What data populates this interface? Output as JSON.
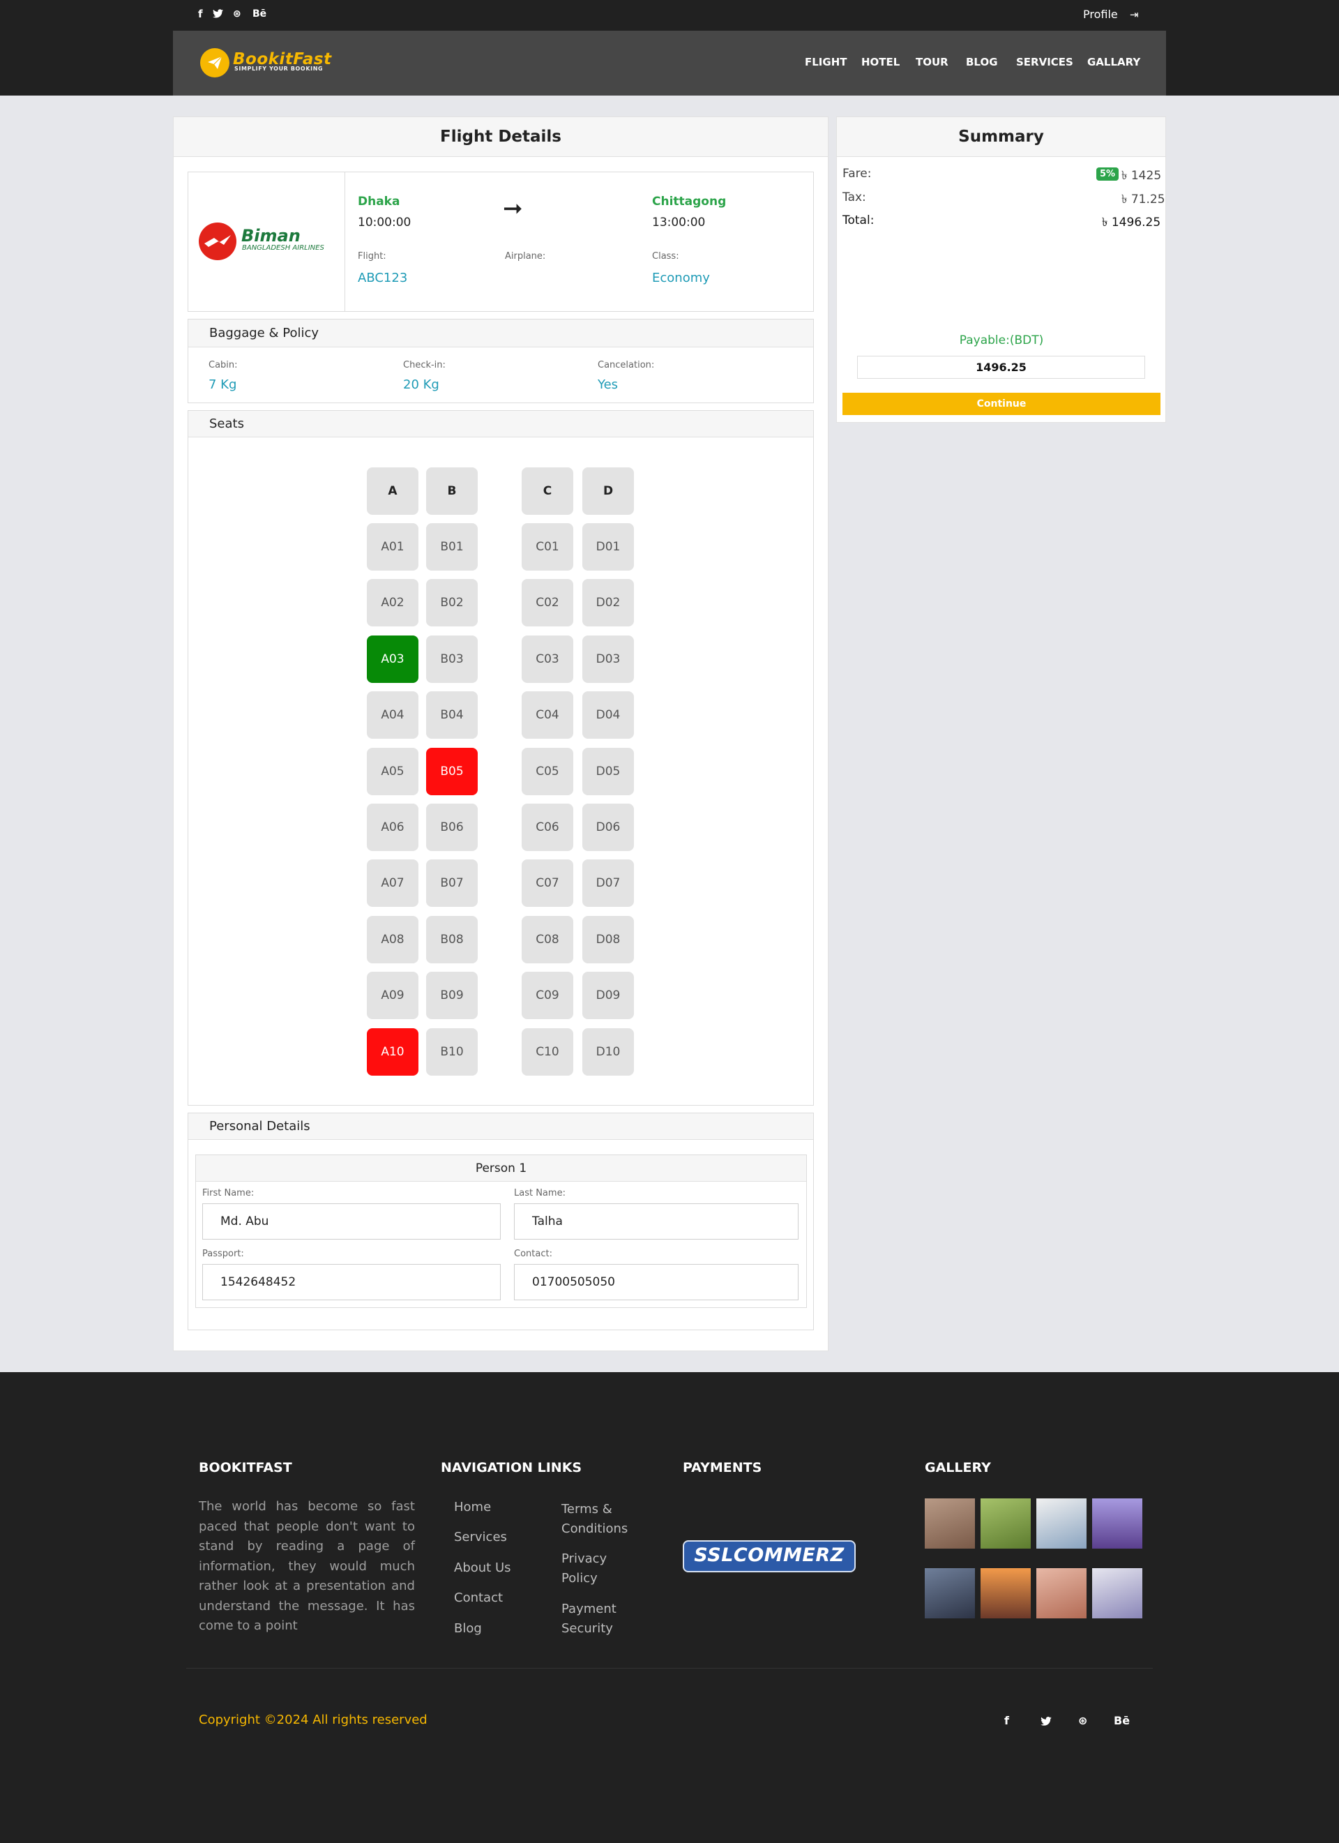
{
  "topbar": {
    "social": [
      "f",
      "🐦",
      "⊛",
      "Bē"
    ],
    "profile_label": "Profile",
    "logout_icon": "⇥"
  },
  "brand": {
    "name": "BookitFast",
    "tagline": "SIMPLIFY YOUR BOOKING"
  },
  "nav": [
    "FLIGHT",
    "HOTEL",
    "TOUR",
    "BLOG",
    "SERVICES",
    "GALLARY"
  ],
  "flight_details": {
    "title": "Flight Details",
    "airline_name": "Biman",
    "airline_sub": "BANGLADESH AIRLINES",
    "from_city": "Dhaka",
    "from_time": "10:00:00",
    "to_city": "Chittagong",
    "to_time": "13:00:00",
    "arrow": "➞",
    "flight_label": "Flight:",
    "flight_value": "ABC123",
    "airplane_label": "Airplane:",
    "class_label": "Class:",
    "class_value": "Economy"
  },
  "baggage": {
    "title": "Baggage & Policy",
    "cabin_label": "Cabin:",
    "cabin_value": "7 Kg",
    "checkin_label": "Check-in:",
    "checkin_value": "20 Kg",
    "cancel_label": "Cancelation:",
    "cancel_value": "Yes"
  },
  "seats": {
    "title": "Seats",
    "columns": [
      "A",
      "B",
      "C",
      "D"
    ],
    "rows": [
      [
        "A01",
        "B01",
        "C01",
        "D01"
      ],
      [
        "A02",
        "B02",
        "C02",
        "D02"
      ],
      [
        "A03",
        "B03",
        "C03",
        "D03"
      ],
      [
        "A04",
        "B04",
        "C04",
        "D04"
      ],
      [
        "A05",
        "B05",
        "C05",
        "D05"
      ],
      [
        "A06",
        "B06",
        "C06",
        "D06"
      ],
      [
        "A07",
        "B07",
        "C07",
        "D07"
      ],
      [
        "A08",
        "B08",
        "C08",
        "D08"
      ],
      [
        "A09",
        "B09",
        "C09",
        "D09"
      ],
      [
        "A10",
        "B10",
        "C10",
        "D10"
      ]
    ],
    "selected": [
      "A03"
    ],
    "booked": [
      "B05",
      "A10"
    ],
    "colors": {
      "default": "#e3e3e3",
      "selected": "#078a07",
      "booked": "#ff0d0d"
    }
  },
  "personal": {
    "title": "Personal Details",
    "person_title": "Person 1",
    "first_name_label": "First Name:",
    "first_name_value": "Md. Abu",
    "last_name_label": "Last Name:",
    "last_name_value": "Talha",
    "passport_label": "Passport:",
    "passport_value": "1542648452",
    "contact_label": "Contact:",
    "contact_value": "01700505050"
  },
  "summary": {
    "title": "Summary",
    "fare_label": "Fare:",
    "fare_badge": "5%",
    "fare_value": "৳ 1425",
    "tax_label": "Tax:",
    "tax_value": "৳ 71.25",
    "total_label": "Total:",
    "total_value": "৳ 1496.25",
    "payable_label": "Payable:(BDT)",
    "payable_value": "1496.25",
    "continue_label": "Continue",
    "accent": "#f7b801"
  },
  "footer": {
    "about_title": "BOOKITFAST",
    "about_text": "The world has become so fast paced that people don't want to stand by reading a page of information, they would much rather look at a presentation and understand the message. It has come to a point",
    "nav_title": "NAVIGATION LINKS",
    "links_col1": [
      "Home",
      "Services",
      "About Us",
      "Contact",
      "Blog"
    ],
    "links_col2": [
      "Terms & Conditions",
      "Privacy Policy",
      "Payment Security"
    ],
    "payments_title": "PAYMENTS",
    "payment_logo": "SSLCOMMERZ",
    "gallery_title": "GALLERY",
    "copyright": "Copyright ©2024 All rights reserved",
    "social": [
      "f",
      "🐦",
      "⊛",
      "Bē"
    ]
  }
}
